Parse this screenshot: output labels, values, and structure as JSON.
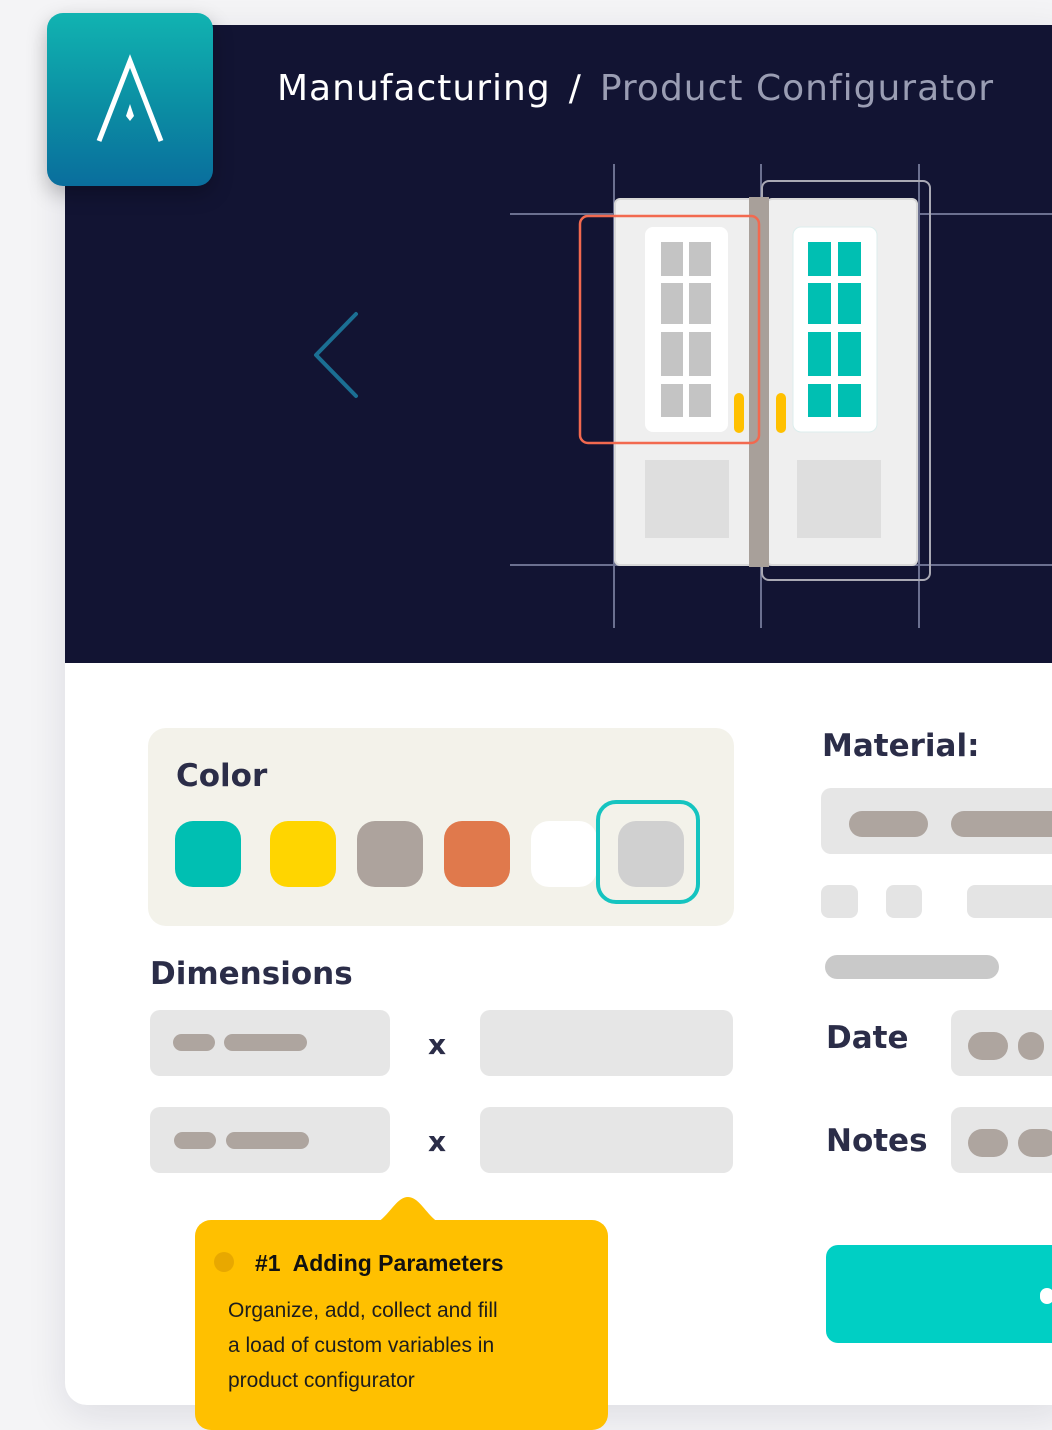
{
  "header": {
    "breadcrumb": {
      "root": "Manufacturing",
      "separator": "/",
      "current": "Product Configurator"
    },
    "logo_icon": "a-monogram-logo",
    "prev_icon": "chevron-left-icon"
  },
  "colors": {
    "hero_background": "#121433",
    "accent_teal": "#00cfc4",
    "selection_outline": "#f2694f"
  },
  "color_section": {
    "title": "Color",
    "swatches": [
      {
        "name": "teal",
        "hex": "#00bfb2"
      },
      {
        "name": "yellow",
        "hex": "#ffd500"
      },
      {
        "name": "taupe",
        "hex": "#ada39d"
      },
      {
        "name": "orange",
        "hex": "#e0794c"
      },
      {
        "name": "white",
        "hex": "#ffffff"
      },
      {
        "name": "light-gray",
        "hex": "#d0d0d0"
      }
    ],
    "selected": "light-gray"
  },
  "dimensions": {
    "title": "Dimensions",
    "separator": "x"
  },
  "material": {
    "title": "Material:"
  },
  "date": {
    "label": "Date"
  },
  "notes": {
    "label": "Notes"
  },
  "callout": {
    "number": "#1",
    "title": "Adding Parameters",
    "body_lines": [
      "Organize, add, collect and fill",
      "a load of custom variables   in",
      "product configurator"
    ]
  }
}
